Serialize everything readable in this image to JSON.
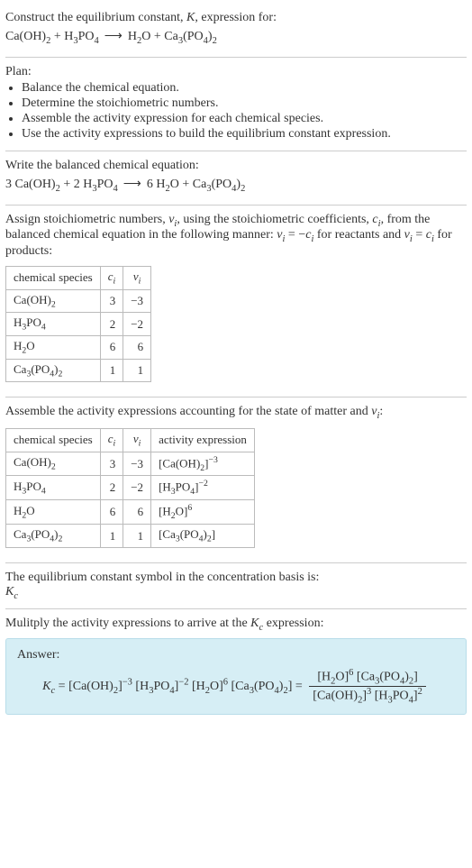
{
  "sec1": {
    "prompt": "Construct the equilibrium constant, ",
    "K": "K",
    "prompt2": ", expression for:",
    "lhs_a": "Ca(OH)",
    "lhs_a_sub": "2",
    "plus1": " + ",
    "lhs_b": "H",
    "lhs_b_sub1": "3",
    "lhs_b_po": "PO",
    "lhs_b_sub2": "4",
    "arrow": "⟶",
    "rhs_a": "H",
    "rhs_a_sub": "2",
    "rhs_a_o": "O",
    "plus2": " + ",
    "rhs_b": "Ca",
    "rhs_b_sub1": "3",
    "rhs_b_po": "(PO",
    "rhs_b_sub2": "4",
    "rhs_b_close": ")",
    "rhs_b_sub3": "2"
  },
  "sec2": {
    "title": "Plan:",
    "bul1": "Balance the chemical equation.",
    "bul2": "Determine the stoichiometric numbers.",
    "bul3": "Assemble the activity expression for each chemical species.",
    "bul4": "Use the activity expressions to build the equilibrium constant expression."
  },
  "sec3": {
    "title": "Write the balanced chemical equation:",
    "c1": "3 ",
    "sp1": "Ca(OH)",
    "sp1s": "2",
    "plus1": " + ",
    "c2": "2 ",
    "sp2a": "H",
    "sp2s1": "3",
    "sp2b": "PO",
    "sp2s2": "4",
    "arrow": "⟶",
    "c3": "6 ",
    "sp3a": "H",
    "sp3s": "2",
    "sp3b": "O",
    "plus2": " + ",
    "sp4a": "Ca",
    "sp4s1": "3",
    "sp4b": "(PO",
    "sp4s2": "4",
    "sp4c": ")",
    "sp4s3": "2"
  },
  "sec4": {
    "p1": "Assign stoichiometric numbers, ",
    "nu1": "ν",
    "isub1": "i",
    "p2": ", using the stoichiometric coefficients, ",
    "c": "c",
    "isub2": "i",
    "p3": ", from the balanced chemical equation in the following manner: ",
    "nu2": "ν",
    "isub3": "i",
    "eq": " = ",
    "neg": "−",
    "c2": "c",
    "isub4": "i",
    "p4": " for reactants and ",
    "nu3": "ν",
    "isub5": "i",
    "eq2": " = ",
    "c3": "c",
    "isub6": "i",
    "p5": " for products:",
    "h1": "chemical species",
    "h2_a": "c",
    "h2_b": "i",
    "h3_a": "ν",
    "h3_b": "i",
    "r1_sp": "Ca(OH)",
    "r1_sub": "2",
    "r1_c": "3",
    "r1_n": "−3",
    "r2_a": "H",
    "r2_s1": "3",
    "r2_b": "PO",
    "r2_s2": "4",
    "r2_c": "2",
    "r2_n": "−2",
    "r3_a": "H",
    "r3_s": "2",
    "r3_b": "O",
    "r3_c": "6",
    "r3_n": "6",
    "r4_a": "Ca",
    "r4_s1": "3",
    "r4_b": "(PO",
    "r4_s2": "4",
    "r4_c": ")",
    "r4_s3": "2",
    "r4_cc": "1",
    "r4_n": "1"
  },
  "sec5": {
    "p1": "Assemble the activity expressions accounting for the state of matter and ",
    "nu": "ν",
    "isub": "i",
    "p2": ":",
    "h4": "activity expression",
    "r1_pre": "[Ca(OH)",
    "r1_sub": "2",
    "r1_close": "]",
    "r1_exp": "−3",
    "r2_pre": "[H",
    "r2_s1": "3",
    "r2_b": "PO",
    "r2_s2": "4",
    "r2_close": "]",
    "r2_exp": "−2",
    "r3_pre": "[H",
    "r3_s": "2",
    "r3_b": "O]",
    "r3_exp": "6",
    "r4_pre": "[Ca",
    "r4_s1": "3",
    "r4_b": "(PO",
    "r4_s2": "4",
    "r4_c": ")",
    "r4_s3": "2",
    "r4_close": "]"
  },
  "sec6": {
    "p1": "The equilibrium constant symbol in the concentration basis is:",
    "K": "K",
    "csub": "c"
  },
  "sec7": {
    "p1": "Mulitply the activity expressions to arrive at the ",
    "K": "K",
    "csub": "c",
    "p2": " expression:"
  },
  "answer": {
    "label": "Answer:",
    "Kc_K": "K",
    "Kc_c": "c",
    "eq": " = ",
    "t1_pre": "[Ca(OH)",
    "t1_sub": "2",
    "t1_close": "]",
    "t1_exp": "−3",
    "t2_pre": " [H",
    "t2_s1": "3",
    "t2_b": "PO",
    "t2_s2": "4",
    "t2_close": "]",
    "t2_exp": "−2",
    "t3_pre": " [H",
    "t3_s": "2",
    "t3_b": "O]",
    "t3_exp": "6",
    "t4_pre": " [Ca",
    "t4_s1": "3",
    "t4_b": "(PO",
    "t4_s2": "4",
    "t4_c": ")",
    "t4_s3": "2",
    "t4_close": "]",
    "eq2": " = ",
    "num_a_pre": "[H",
    "num_a_s": "2",
    "num_a_b": "O]",
    "num_a_exp": "6",
    "num_b_pre": " [Ca",
    "num_b_s1": "3",
    "num_b_b": "(PO",
    "num_b_s2": "4",
    "num_b_c": ")",
    "num_b_s3": "2",
    "num_b_close": "]",
    "den_a_pre": "[Ca(OH)",
    "den_a_s": "2",
    "den_a_close": "]",
    "den_a_exp": "3",
    "den_b_pre": " [H",
    "den_b_s1": "3",
    "den_b_b": "PO",
    "den_b_s2": "4",
    "den_b_close": "]",
    "den_b_exp": "2"
  },
  "chart_data": {
    "type": "table",
    "title": "Stoichiometric and activity data",
    "tables": [
      {
        "columns": [
          "chemical species",
          "c_i",
          "ν_i"
        ],
        "rows": [
          [
            "Ca(OH)2",
            3,
            -3
          ],
          [
            "H3PO4",
            2,
            -2
          ],
          [
            "H2O",
            6,
            6
          ],
          [
            "Ca3(PO4)2",
            1,
            1
          ]
        ]
      },
      {
        "columns": [
          "chemical species",
          "c_i",
          "ν_i",
          "activity expression"
        ],
        "rows": [
          [
            "Ca(OH)2",
            3,
            -3,
            "[Ca(OH)2]^-3"
          ],
          [
            "H3PO4",
            2,
            -2,
            "[H3PO4]^-2"
          ],
          [
            "H2O",
            6,
            6,
            "[H2O]^6"
          ],
          [
            "Ca3(PO4)2",
            1,
            1,
            "[Ca3(PO4)2]"
          ]
        ]
      }
    ]
  }
}
